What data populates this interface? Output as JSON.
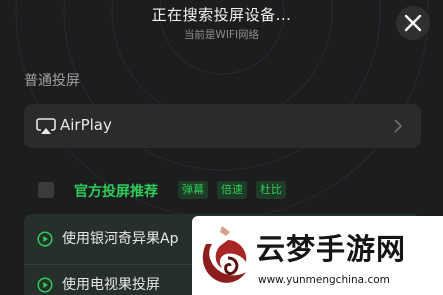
{
  "header": {
    "title": "正在搜索投屏设备...",
    "subtitle": "当前是WIFI网络"
  },
  "icons": {
    "close": "close-icon",
    "airplay": "airplay-icon",
    "chevron": "chevron-right-icon",
    "play": "play-circle-icon",
    "logo": "watermark-logo-icon"
  },
  "sections": {
    "normal_label": "普通投屏",
    "airplay_label": "AirPlay"
  },
  "recommended": {
    "title": "官方投屏推荐",
    "tags": [
      "弹幕",
      "倍速",
      "杜比"
    ]
  },
  "devices": [
    {
      "label": "使用银河奇异果Ap"
    },
    {
      "label": "使用电视果投屏"
    }
  ],
  "watermark": {
    "text": "云梦手游网",
    "url": "www.yunmengchina.com"
  },
  "colors": {
    "background": "#1c1d1f",
    "accent_green": "#2ecb5a",
    "card": "#2a2b2d",
    "device_row": "#25302a"
  }
}
